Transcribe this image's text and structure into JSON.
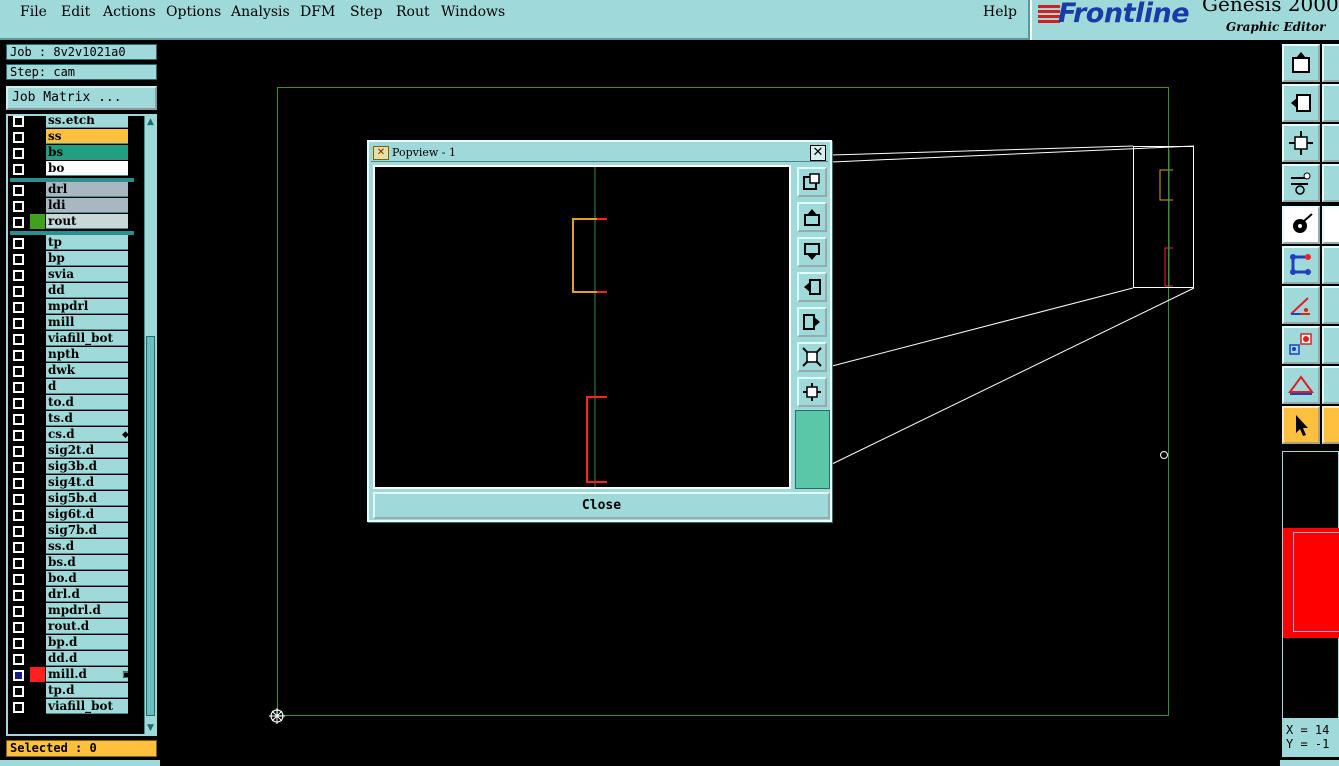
{
  "menu": {
    "items": [
      "File",
      "Edit",
      "Actions",
      "Options",
      "Analysis",
      "DFM",
      "Step",
      "Rout",
      "Windows"
    ],
    "help": "Help"
  },
  "brand": {
    "logo": "Frontline",
    "product": "Genesis 2000",
    "subtitle": "Graphic Editor"
  },
  "job": {
    "job_label": "Job : 8v2v1021a0",
    "step_label": "Step: cam",
    "matrix_button": "Job Matrix ..."
  },
  "layers": [
    {
      "name": "ss.etch",
      "color": "#9fd9d9",
      "checked": false,
      "group": 0
    },
    {
      "name": "ss",
      "color": "#ffc040",
      "checked": false,
      "group": 0
    },
    {
      "name": "bs",
      "color": "#20a080",
      "checked": false,
      "group": 0
    },
    {
      "name": "bo",
      "color": "#ffffff",
      "checked": false,
      "group": 0
    },
    {
      "name": "drl",
      "color": "#a8b8c0",
      "checked": false,
      "group": 1
    },
    {
      "name": "ldi",
      "color": "#a8b8c0",
      "checked": false,
      "group": 1
    },
    {
      "name": "rout",
      "color": "#c8d8d8",
      "checked": false,
      "group": 1,
      "swatch": "#40a020"
    },
    {
      "name": "tp",
      "color": "#9fd9d9",
      "checked": false,
      "group": 2
    },
    {
      "name": "bp",
      "color": "#9fd9d9",
      "checked": false,
      "group": 2
    },
    {
      "name": "svia",
      "color": "#9fd9d9",
      "checked": false,
      "group": 2
    },
    {
      "name": "dd",
      "color": "#9fd9d9",
      "checked": false,
      "group": 2
    },
    {
      "name": "mpdrl",
      "color": "#9fd9d9",
      "checked": false,
      "group": 2
    },
    {
      "name": "mill",
      "color": "#9fd9d9",
      "checked": false,
      "group": 2
    },
    {
      "name": "viafill_bot",
      "color": "#9fd9d9",
      "checked": false,
      "group": 2
    },
    {
      "name": "npth",
      "color": "#9fd9d9",
      "checked": false,
      "group": 2
    },
    {
      "name": "dwk",
      "color": "#9fd9d9",
      "checked": false,
      "group": 2
    },
    {
      "name": "d",
      "color": "#9fd9d9",
      "checked": false,
      "group": 2
    },
    {
      "name": "to.d",
      "color": "#9fd9d9",
      "checked": false,
      "group": 2
    },
    {
      "name": "ts.d",
      "color": "#9fd9d9",
      "checked": false,
      "group": 2
    },
    {
      "name": "cs.d",
      "color": "#9fd9d9",
      "checked": false,
      "group": 2,
      "mark": "◆"
    },
    {
      "name": "sig2t.d",
      "color": "#9fd9d9",
      "checked": false,
      "group": 2
    },
    {
      "name": "sig3b.d",
      "color": "#9fd9d9",
      "checked": false,
      "group": 2
    },
    {
      "name": "sig4t.d",
      "color": "#9fd9d9",
      "checked": false,
      "group": 2
    },
    {
      "name": "sig5b.d",
      "color": "#9fd9d9",
      "checked": false,
      "group": 2
    },
    {
      "name": "sig6t.d",
      "color": "#9fd9d9",
      "checked": false,
      "group": 2
    },
    {
      "name": "sig7b.d",
      "color": "#9fd9d9",
      "checked": false,
      "group": 2
    },
    {
      "name": "ss.d",
      "color": "#9fd9d9",
      "checked": false,
      "group": 2
    },
    {
      "name": "bs.d",
      "color": "#9fd9d9",
      "checked": false,
      "group": 2
    },
    {
      "name": "bo.d",
      "color": "#9fd9d9",
      "checked": false,
      "group": 2
    },
    {
      "name": "drl.d",
      "color": "#9fd9d9",
      "checked": false,
      "group": 2
    },
    {
      "name": "mpdrl.d",
      "color": "#9fd9d9",
      "checked": false,
      "group": 2
    },
    {
      "name": "rout.d",
      "color": "#9fd9d9",
      "checked": false,
      "group": 2
    },
    {
      "name": "bp.d",
      "color": "#9fd9d9",
      "checked": false,
      "group": 2
    },
    {
      "name": "dd.d",
      "color": "#9fd9d9",
      "checked": false,
      "group": 2
    },
    {
      "name": "mill.d",
      "color": "#9fd9d9",
      "checked": true,
      "group": 2,
      "swatch": "#ff2020",
      "mark": "▣"
    },
    {
      "name": "tp.d",
      "color": "#9fd9d9",
      "checked": false,
      "group": 2
    },
    {
      "name": "viafill_bot",
      "color": "#9fd9d9",
      "checked": false,
      "group": 2
    }
  ],
  "status": {
    "selected": "Selected : 0"
  },
  "popview": {
    "title": "Popview - 1",
    "close_button": "Close",
    "tools": [
      "zoom-home-icon",
      "pan-up-icon",
      "pan-down-icon",
      "pan-left-icon",
      "pan-right-icon",
      "zoom-in-icon",
      "zoom-out-icon"
    ]
  },
  "coords": {
    "x": "X = 14",
    "y": "Y = -1"
  },
  "colors": {
    "panel": "#9fd9d9",
    "profile": "#3c8c3c",
    "feature_red": "#ff2020",
    "feature_orange": "#e0a020"
  }
}
